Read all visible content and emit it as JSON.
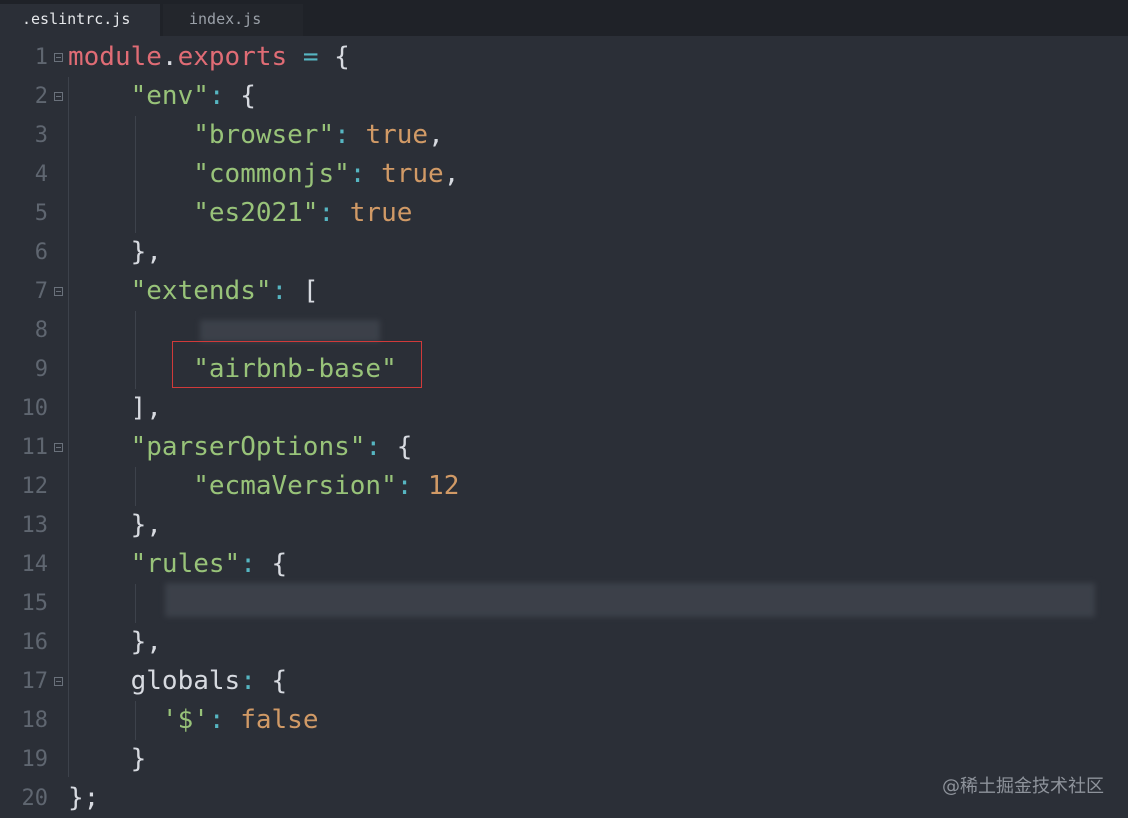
{
  "tabs": [
    {
      "label": ".eslintrc.js",
      "active": true
    },
    {
      "label": "index.js",
      "active": false
    }
  ],
  "lines": [
    {
      "num": "1",
      "fold": true,
      "tokens": [
        [
          "ident",
          "module"
        ],
        [
          "punc",
          "."
        ],
        [
          "ident",
          "exports"
        ],
        [
          "plain",
          " "
        ],
        [
          "op",
          "="
        ],
        [
          "plain",
          " "
        ],
        [
          "punc",
          "{"
        ]
      ]
    },
    {
      "num": "2",
      "fold": true,
      "tokens": [
        [
          "plain",
          "    "
        ],
        [
          "str",
          "\"env\""
        ],
        [
          "op",
          ":"
        ],
        [
          "plain",
          " "
        ],
        [
          "punc",
          "{"
        ]
      ]
    },
    {
      "num": "3",
      "fold": false,
      "tokens": [
        [
          "plain",
          "        "
        ],
        [
          "str",
          "\"browser\""
        ],
        [
          "op",
          ":"
        ],
        [
          "plain",
          " "
        ],
        [
          "kw",
          "true"
        ],
        [
          "punc",
          ","
        ]
      ]
    },
    {
      "num": "4",
      "fold": false,
      "tokens": [
        [
          "plain",
          "        "
        ],
        [
          "str",
          "\"commonjs\""
        ],
        [
          "op",
          ":"
        ],
        [
          "plain",
          " "
        ],
        [
          "kw",
          "true"
        ],
        [
          "punc",
          ","
        ]
      ]
    },
    {
      "num": "5",
      "fold": false,
      "tokens": [
        [
          "plain",
          "        "
        ],
        [
          "str",
          "\"es2021\""
        ],
        [
          "op",
          ":"
        ],
        [
          "plain",
          " "
        ],
        [
          "kw",
          "true"
        ]
      ]
    },
    {
      "num": "6",
      "fold": false,
      "tokens": [
        [
          "plain",
          "    "
        ],
        [
          "punc",
          "},"
        ]
      ]
    },
    {
      "num": "7",
      "fold": true,
      "tokens": [
        [
          "plain",
          "    "
        ],
        [
          "str",
          "\"extends\""
        ],
        [
          "op",
          ":"
        ],
        [
          "plain",
          " "
        ],
        [
          "punc",
          "["
        ]
      ]
    },
    {
      "num": "8",
      "fold": false,
      "tokens": []
    },
    {
      "num": "9",
      "fold": false,
      "tokens": [
        [
          "plain",
          "        "
        ],
        [
          "str",
          "\"airbnb-base\""
        ]
      ]
    },
    {
      "num": "10",
      "fold": false,
      "tokens": [
        [
          "plain",
          "    "
        ],
        [
          "punc",
          "],"
        ]
      ]
    },
    {
      "num": "11",
      "fold": true,
      "tokens": [
        [
          "plain",
          "    "
        ],
        [
          "str",
          "\"parserOptions\""
        ],
        [
          "op",
          ":"
        ],
        [
          "plain",
          " "
        ],
        [
          "punc",
          "{"
        ]
      ]
    },
    {
      "num": "12",
      "fold": false,
      "tokens": [
        [
          "plain",
          "        "
        ],
        [
          "str",
          "\"ecmaVersion\""
        ],
        [
          "op",
          ":"
        ],
        [
          "plain",
          " "
        ],
        [
          "num",
          "12"
        ]
      ]
    },
    {
      "num": "13",
      "fold": false,
      "tokens": [
        [
          "plain",
          "    "
        ],
        [
          "punc",
          "},"
        ]
      ]
    },
    {
      "num": "14",
      "fold": false,
      "tokens": [
        [
          "plain",
          "    "
        ],
        [
          "str",
          "\"rules\""
        ],
        [
          "op",
          ":"
        ],
        [
          "plain",
          " "
        ],
        [
          "punc",
          "{"
        ]
      ]
    },
    {
      "num": "15",
      "fold": false,
      "tokens": []
    },
    {
      "num": "16",
      "fold": false,
      "tokens": [
        [
          "plain",
          "    "
        ],
        [
          "punc",
          "},"
        ]
      ]
    },
    {
      "num": "17",
      "fold": true,
      "tokens": [
        [
          "plain",
          "    "
        ],
        [
          "plain",
          "globals"
        ],
        [
          "op",
          ":"
        ],
        [
          "plain",
          " "
        ],
        [
          "punc",
          "{"
        ]
      ]
    },
    {
      "num": "18",
      "fold": false,
      "tokens": [
        [
          "plain",
          "      "
        ],
        [
          "str",
          "'$'"
        ],
        [
          "op",
          ":"
        ],
        [
          "plain",
          " "
        ],
        [
          "kw",
          "false"
        ]
      ]
    },
    {
      "num": "19",
      "fold": false,
      "tokens": [
        [
          "plain",
          "    "
        ],
        [
          "punc",
          "}"
        ]
      ]
    },
    {
      "num": "20",
      "fold": false,
      "tokens": [
        [
          "punc",
          "};"
        ]
      ]
    }
  ],
  "watermark": "@稀土掘金技术社区"
}
